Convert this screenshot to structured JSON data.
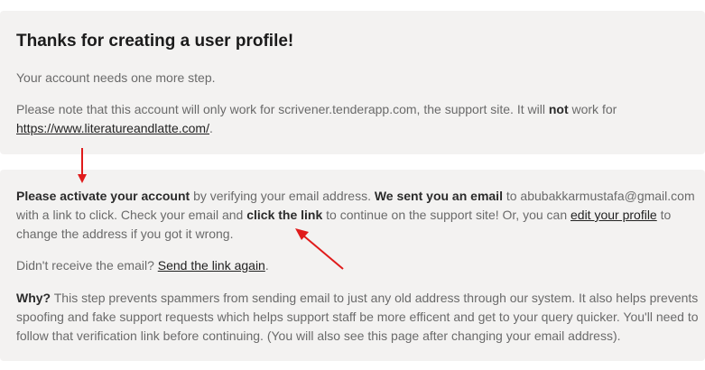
{
  "intro": {
    "heading": "Thanks for creating a user profile!",
    "needs_step": "Your account needs one more step.",
    "note_1": "Please note that this account will only work for scrivener.tenderapp.com, the support site. It will ",
    "note_bold": "not",
    "note_2": " work for",
    "note_link": "https://www.literatureandlatte.com/",
    "note_end": "."
  },
  "activation": {
    "l1_bold1": "Please activate your account",
    "l1_t1": " by verifying your email address. ",
    "l1_bold2": "We sent you an email",
    "l1_t2": " to abubakkarmustafa@gmail.com",
    "l2_t1": "with a link to click. Check your email and ",
    "l2_bold": "click the link",
    "l2_t2": " to continue on the support site! Or, you can ",
    "l2_link": "edit your profile",
    "l2_t3": " to",
    "l3": "change the address if you got it wrong.",
    "resend_text": "Didn't receive the email? ",
    "resend_link": "Send the link again",
    "resend_end": ".",
    "why_bold": "Why?",
    "why_l1": " This step prevents spammers from sending email to just any old address through our system. It also helps prevents",
    "why_l2": "spoofing and fake support requests which helps support staff be more efficent and get to your query quicker. You'll need to",
    "why_l3": "follow that verification link before continuing. (You will also see this page after changing your email address)."
  },
  "colors": {
    "card_bg": "#f3f2f1",
    "annotation_arrow": "#e01b1b"
  }
}
